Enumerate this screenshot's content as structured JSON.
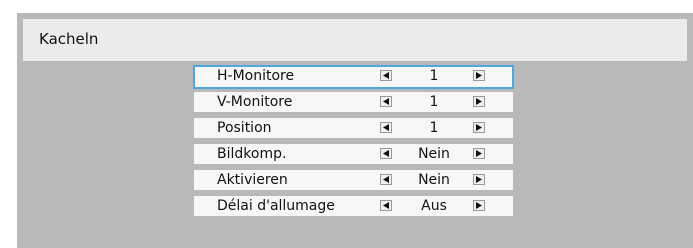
{
  "dialog": {
    "title": "Kacheln"
  },
  "menu": {
    "items": [
      {
        "label": "H-Monitore",
        "value": "1",
        "selected": true
      },
      {
        "label": "V-Monitore",
        "value": "1",
        "selected": false
      },
      {
        "label": "Position",
        "value": "1",
        "selected": false
      },
      {
        "label": "Bildkomp.",
        "value": "Nein",
        "selected": false
      },
      {
        "label": "Aktivieren",
        "value": "Nein",
        "selected": false
      },
      {
        "label": "Délai d'allumage",
        "value": "Aus",
        "selected": false
      }
    ]
  },
  "colors": {
    "panel_background": "#b9b9b9",
    "title_background": "#ececec",
    "row_background": "#f7f7f7",
    "selection_outline": "#4fa7df"
  },
  "icons": {
    "decrease": "arrow-left-icon",
    "increase": "arrow-right-icon"
  }
}
